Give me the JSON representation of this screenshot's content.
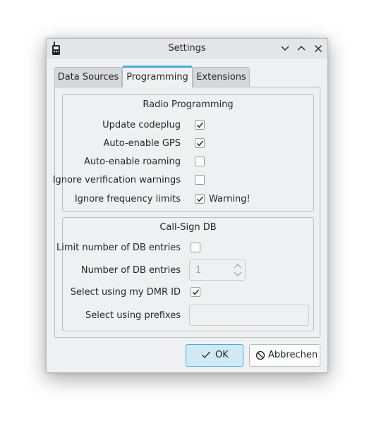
{
  "window": {
    "title": "Settings"
  },
  "tabs": [
    {
      "label": "Data Sources"
    },
    {
      "label": "Programming"
    },
    {
      "label": "Extensions"
    }
  ],
  "radio_programming": {
    "title": "Radio Programming",
    "rows": [
      {
        "label": "Update codeplug",
        "checked": true
      },
      {
        "label": "Auto-enable GPS",
        "checked": true
      },
      {
        "label": "Auto-enable roaming",
        "checked": false
      },
      {
        "label": "Ignore verification warnings",
        "checked": false
      },
      {
        "label": "Ignore frequency limits",
        "checked": true,
        "note": "Warning!"
      }
    ]
  },
  "callsign_db": {
    "title": "Call-Sign DB",
    "limit_label": "Limit number of DB entries",
    "limit_checked": false,
    "number_label": "Number of DB entries",
    "number_value": "1",
    "dmr_id_label": "Select using my DMR ID",
    "dmr_id_checked": true,
    "prefixes_label": "Select using prefixes",
    "prefixes_value": ""
  },
  "buttons": {
    "ok": "OK",
    "cancel": "Abbrechen"
  },
  "colors": {
    "accent": "#3daee9",
    "window_bg": "#eff0f1",
    "check": "#31363b"
  }
}
